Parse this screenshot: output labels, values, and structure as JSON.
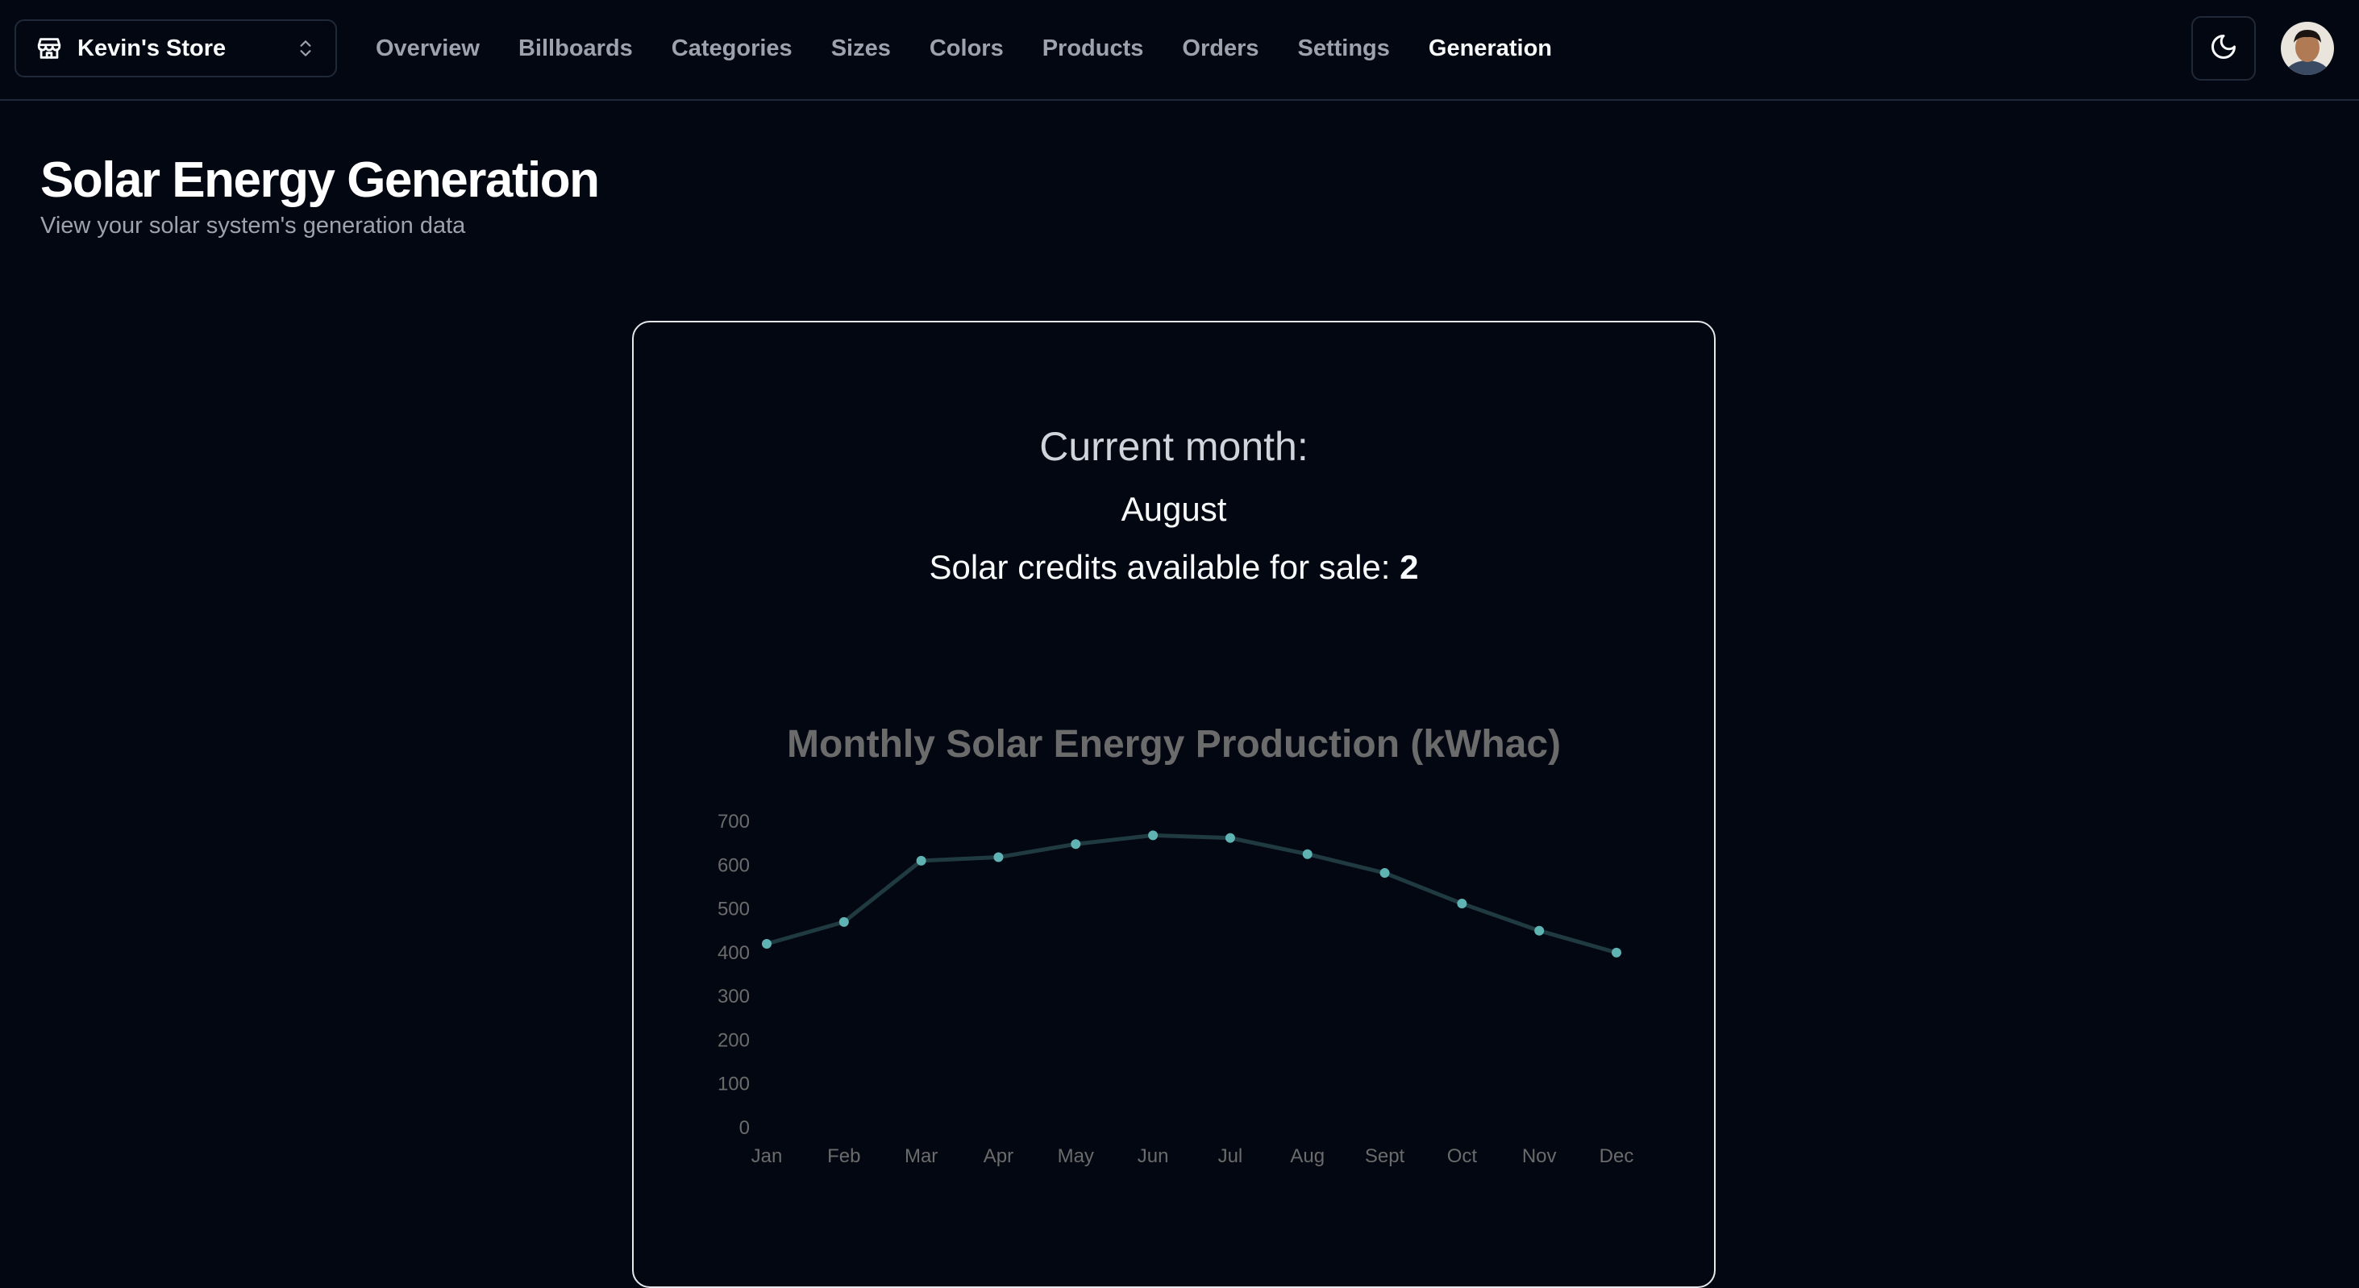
{
  "header": {
    "store_name": "Kevin's Store",
    "nav": [
      {
        "label": "Overview",
        "active": false
      },
      {
        "label": "Billboards",
        "active": false
      },
      {
        "label": "Categories",
        "active": false
      },
      {
        "label": "Sizes",
        "active": false
      },
      {
        "label": "Colors",
        "active": false
      },
      {
        "label": "Products",
        "active": false
      },
      {
        "label": "Orders",
        "active": false
      },
      {
        "label": "Settings",
        "active": false
      },
      {
        "label": "Generation",
        "active": true
      }
    ],
    "icons": {
      "store": "store-icon",
      "switcher": "chevrons-up-down-icon",
      "theme": "moon-icon",
      "avatar": "user-avatar"
    }
  },
  "page": {
    "title": "Solar Energy Generation",
    "subtitle": "View your solar system's generation data"
  },
  "card": {
    "current_label": "Current month:",
    "current_month": "August",
    "credits_label": "Solar credits available for sale: ",
    "credits_value": "2"
  },
  "colors": {
    "background": "#030712",
    "border": "#1f2937",
    "line": "#1f3a40",
    "point": "#5fb3b3",
    "axis_text": "#6b6b6b"
  },
  "chart_data": {
    "type": "line",
    "title": "Monthly Solar Energy Production (kWhac)",
    "categories": [
      "Jan",
      "Feb",
      "Mar",
      "Apr",
      "May",
      "Jun",
      "Jul",
      "Aug",
      "Sept",
      "Oct",
      "Nov",
      "Dec"
    ],
    "values": [
      420,
      470,
      610,
      618,
      648,
      668,
      662,
      625,
      582,
      512,
      450,
      400
    ],
    "yticks": [
      0,
      100,
      200,
      300,
      400,
      500,
      600,
      700
    ],
    "ylim": [
      0,
      700
    ],
    "xlabel": "",
    "ylabel": "",
    "grid": false,
    "legend": "none"
  }
}
